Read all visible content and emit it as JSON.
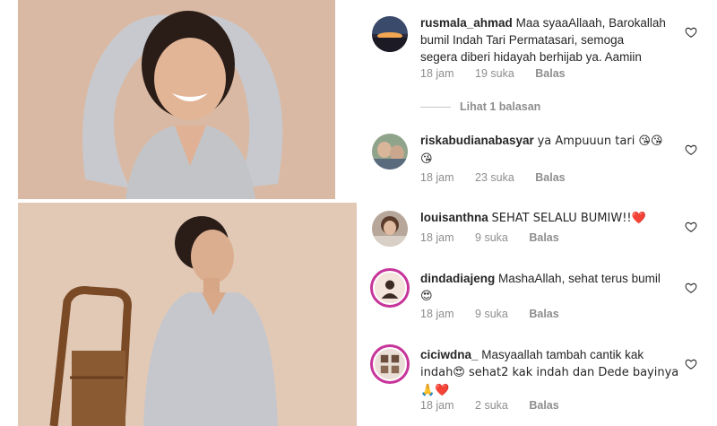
{
  "comments": [
    {
      "username": "rusmala_ahmad",
      "text_lines": [
        "Maa syaaAllaah, Barokallah",
        "bumil Indah Tari Permatasari, semoga",
        "segera diberi hidayah berhijab ya. Aamiin"
      ],
      "time": "18 jam",
      "likes": "19 suka",
      "reply": "Balas"
    },
    {
      "username": "riskabudianabasyar",
      "text_lines": [
        "ya Ampuuun tari 😘😘",
        "😘"
      ],
      "time": "18 jam",
      "likes": "23 suka",
      "reply": "Balas"
    },
    {
      "username": "louisanthna",
      "text_lines": [
        "SEHAT SELALU BUMIW!!❤️"
      ],
      "time": "18 jam",
      "likes": "9 suka",
      "reply": "Balas"
    },
    {
      "username": "dindadiajeng",
      "text_lines": [
        "MashaAllah, sehat terus bumil",
        "😍"
      ],
      "time": "18 jam",
      "likes": "9 suka",
      "reply": "Balas"
    },
    {
      "username": "ciciwdna_",
      "text_lines": [
        "Masyaallah tambah cantik kak",
        "indah😍 sehat2 kak indah dan Dede bayinya",
        "🙏❤️"
      ],
      "time": "18 jam",
      "likes": "2 suka",
      "reply": "Balas"
    }
  ],
  "view_replies": "Lihat 1 balasan",
  "icons": {
    "like": "heart-outline-icon"
  },
  "colors": {
    "secondary_text": "#8e8e8e",
    "story_ring": "#c7359a"
  }
}
